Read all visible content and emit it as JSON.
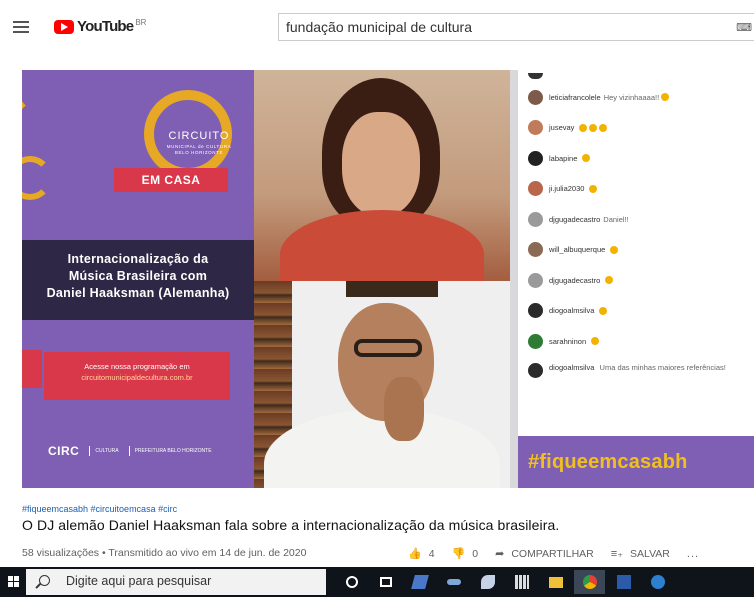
{
  "header": {
    "logo_text": "YouTube",
    "country": "BR",
    "search_value": "fundação municipal de cultura"
  },
  "video": {
    "poster": {
      "circ_title": "CIRCUITO",
      "circ_sub": "MUNICIPAL de CULTURA BELO HORIZONTE",
      "em_casa": "EM CASA",
      "band_line1": "Internacionalização da",
      "band_line2": "Música Brasileira com",
      "band_line3": "Daniel Haaksman (Alemanha)",
      "prog_line1": "Acesse nossa programação em",
      "prog_url": "circuitomunicipaldecultura.com.br",
      "footer_circ": "CIRC",
      "footer_logo2": "CULTURA",
      "footer_logo3": "PREFEITURA BELO HORIZONTE"
    },
    "chat": [
      {
        "name": "leticiafrancolele",
        "msg": "Hey vizinhaaaa!!",
        "avatar_color": "#7d5a4a"
      },
      {
        "name": "jusevay",
        "msg": "",
        "avatar_color": "#c07b5a"
      },
      {
        "name": "labapine",
        "msg": "",
        "avatar_color": "#222222"
      },
      {
        "name": "ji.julia2030",
        "msg": "",
        "avatar_color": "#b9664a"
      },
      {
        "name": "djgugadecastro",
        "msg": "Daniel!!",
        "avatar_color": "#9a9a9a"
      },
      {
        "name": "will_albuquerque",
        "msg": "",
        "avatar_color": "#8a6a52"
      },
      {
        "name": "djgugadecastro",
        "msg": "",
        "avatar_color": "#9a9a9a"
      },
      {
        "name": "diogoalmsilva",
        "msg": "",
        "avatar_color": "#2b2b2b"
      },
      {
        "name": "sarahninon",
        "msg": "",
        "avatar_color": "#2f7a35"
      },
      {
        "name": "diogoalmsilva",
        "msg": "Uma das minhas maiores referências!",
        "avatar_color": "#2b2b2b"
      }
    ],
    "hashtag": "#fiqueemcasabh"
  },
  "info": {
    "tags": "#fiqueemcasabh #circuitoemcasa #circ",
    "title": "O DJ alemão Daniel Haaksman fala sobre a internacionalização da música brasileira.",
    "meta": "58 visualizações • Transmitido ao vivo em 14 de jun. de 2020",
    "likes": "4",
    "dislikes": "0",
    "share": "COMPARTILHAR",
    "save": "SALVAR",
    "more": "..."
  },
  "taskbar": {
    "search_placeholder": "Digite aqui para pesquisar",
    "icons": [
      "cortana-icon",
      "task-view-icon",
      "app-icon",
      "app-icon",
      "app-icon",
      "calculator-icon",
      "file-explorer-icon",
      "chrome-icon",
      "word-icon",
      "edge-icon"
    ]
  },
  "colors": {
    "poster_purple": "#7f5fb3",
    "accent_yellow": "#e6a825",
    "accent_red": "#d8384a",
    "youtube_red": "#ff0000"
  }
}
